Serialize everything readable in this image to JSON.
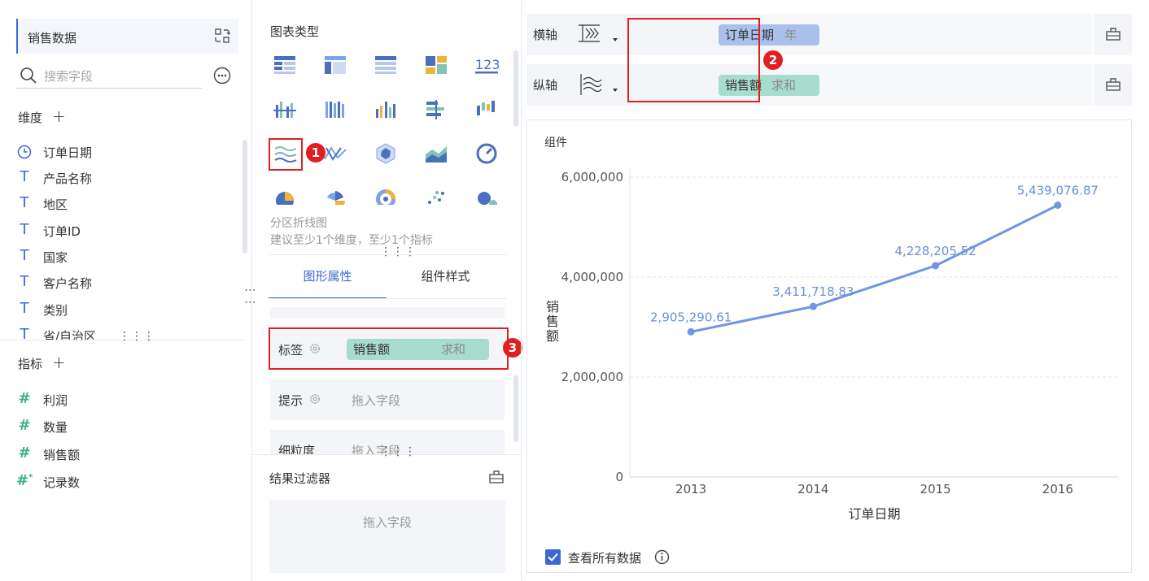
{
  "left_panel": {
    "dataset_name": "销售数据",
    "search_placeholder": "搜索字段",
    "dimensions_title": "维度",
    "dimensions": [
      {
        "icon": "clock-icon",
        "label": "订单日期"
      },
      {
        "icon": "text-icon",
        "label": "产品名称"
      },
      {
        "icon": "text-icon",
        "label": "地区"
      },
      {
        "icon": "text-icon",
        "label": "订单ID"
      },
      {
        "icon": "text-icon",
        "label": "国家"
      },
      {
        "icon": "text-icon",
        "label": "客户名称"
      },
      {
        "icon": "text-icon",
        "label": "类别"
      },
      {
        "icon": "text-icon",
        "label": "省/自治区"
      }
    ],
    "measures_title": "指标",
    "measures": [
      {
        "icon": "hash-icon",
        "label": "利润"
      },
      {
        "icon": "hash-icon",
        "label": "数量"
      },
      {
        "icon": "hash-icon",
        "label": "销售额"
      },
      {
        "icon": "hash-star-icon",
        "label": "记录数"
      }
    ]
  },
  "middle_panel": {
    "chart_type_title": "图表类型",
    "selected_chart_name": "分区折线图",
    "selected_chart_hint": "建议至少1个维度，至少1个指标",
    "tabs": [
      "图形属性",
      "组件样式"
    ],
    "active_tab": "图形属性",
    "props": {
      "label_title": "标签",
      "label_field": "销售额",
      "label_agg": "求和",
      "tooltip_title": "提示",
      "tooltip_placeholder": "拖入字段",
      "granularity_title": "细粒度",
      "granularity_placeholder": "拖入字段"
    },
    "result_filter_title": "结果过滤器",
    "result_filter_placeholder": "拖入字段",
    "annotations": [
      "1",
      "3"
    ]
  },
  "right_panel": {
    "x_axis_label": "横轴",
    "x_axis_field": "订单日期",
    "x_axis_field_sub": "年",
    "y_axis_label": "纵轴",
    "y_axis_field": "销售额",
    "y_axis_field_sub": "求和",
    "annotation": "2",
    "card_title": "组件",
    "view_all_label": "查看所有数据"
  },
  "colors": {
    "accent": "#3b68d6",
    "line": "#7094e6",
    "label_text": "#6a8fd9",
    "annotation_red": "#e02020",
    "pill_green": "#a8dccd",
    "pill_blue": "#a9c1ea"
  },
  "chart_data": {
    "type": "line",
    "categories": [
      "2013",
      "2014",
      "2015",
      "2016"
    ],
    "values": [
      2905290.61,
      3411718.83,
      4228205.52,
      5439076.87
    ],
    "labels": [
      "2,905,290.61",
      "3,411,718.83",
      "4,228,205.52",
      "5,439,076.87"
    ],
    "y_ticks": [
      "6,000,000",
      "4,000,000",
      "2,000,000",
      "0"
    ],
    "tick_values": [
      6000000,
      4000000,
      2000000,
      0
    ],
    "xlabel": "订单日期",
    "ylabel": "销售额",
    "ylim": [
      0,
      6000000
    ],
    "grid": true
  }
}
